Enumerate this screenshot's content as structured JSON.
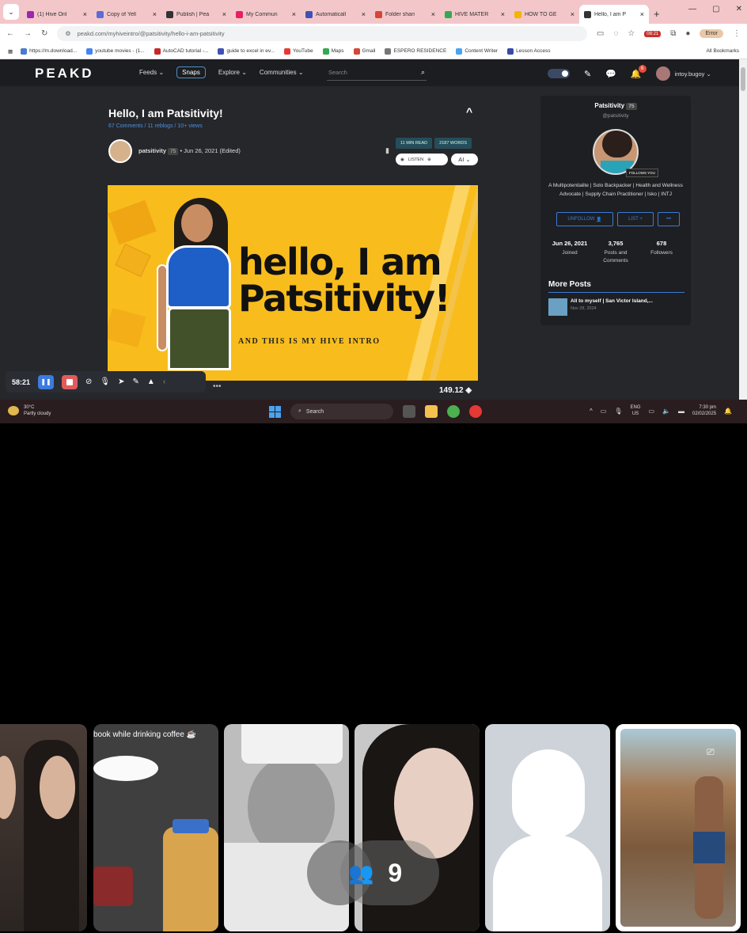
{
  "browser": {
    "tabs": [
      {
        "title": "(1) Hive Onl",
        "color": "#9c27b0"
      },
      {
        "title": "Copy of Yell",
        "color": "#5b6cd6"
      },
      {
        "title": "Publish | Pea",
        "color": "#333333"
      },
      {
        "title": "My Commun",
        "color": "#e91e63"
      },
      {
        "title": "Automaticall",
        "color": "#3f51b5"
      },
      {
        "title": "Folder shari",
        "color": "#d44638"
      },
      {
        "title": "HIVE MATER",
        "color": "#34a853"
      },
      {
        "title": "HOW TO GE",
        "color": "#f4b400"
      },
      {
        "title": "Hello, I am P",
        "color": "#333333",
        "active": true
      }
    ],
    "url": "peakd.com/myhiveintro/@patsitivity/hello-i-am-patsitivity",
    "bookmarks": [
      "https://m.download...",
      "youtube movies - (1...",
      "AutoCAD tutorial -...",
      "guide to excel in ev...",
      "YouTube",
      "Maps",
      "Gmail",
      "ESPERO RESIDENCE",
      "Content Writer",
      "Lesson Access"
    ],
    "all_bookmarks": "All Bookmarks",
    "profile_label": "Error",
    "ext_badge": "08:21"
  },
  "peakd": {
    "logo": "PEAKD",
    "nav": [
      "Feeds ⌄",
      "Snaps",
      "Explore ⌄",
      "Communities ⌄"
    ],
    "search_placeholder": "Search",
    "notif_count": "6",
    "username": "intoy.bugoy ⌄"
  },
  "post": {
    "title": "Hello, I am Patsitivity!",
    "meta": "67 Comments / 11 reblogs / 10+ views",
    "author": "patsitivity",
    "author_rep": "75",
    "date": "• Jun 26, 2021 (Edited)",
    "read_time": "11 MIN READ",
    "words": "2187 WORDS",
    "listen": "LISTEN",
    "ai": "AI ⌄",
    "banner_line1": "hello, I am",
    "banner_line2": "Patsitivity!",
    "banner_sub": "AND THIS IS MY HIVE INTRO",
    "payout": "149.12"
  },
  "profile": {
    "name": "Patsitivity",
    "rep": "75",
    "handle": "@patsitivity",
    "follows_you": "FOLLOWS YOU",
    "about": "A Multipotentialite | Solo Backpacker | Health and Wellness Advocate | Supply Chain Practitioner | Isko | INTJ",
    "unfollow": "UNFOLLOW",
    "list": "LIST +",
    "more": "•••",
    "stats": [
      {
        "value": "Jun 26, 2021",
        "label": "Joined"
      },
      {
        "value": "3,765",
        "label": "Posts and Comments"
      },
      {
        "value": "678",
        "label": "Followers"
      }
    ],
    "more_posts_title": "More Posts",
    "more_post": {
      "title": "All to myself | San Victor Island,...",
      "date": "Nov 28, 2024"
    }
  },
  "recorder": {
    "time": "58:21"
  },
  "taskbar": {
    "temp": "30°C",
    "weather": "Partly cloudy",
    "search": "Search",
    "lang1": "ENG",
    "lang2": "US",
    "time": "7:30 pm",
    "date": "02/02/2025"
  },
  "meeting": {
    "caption": "book while drinking coffee ☕",
    "participant_count": "9"
  }
}
